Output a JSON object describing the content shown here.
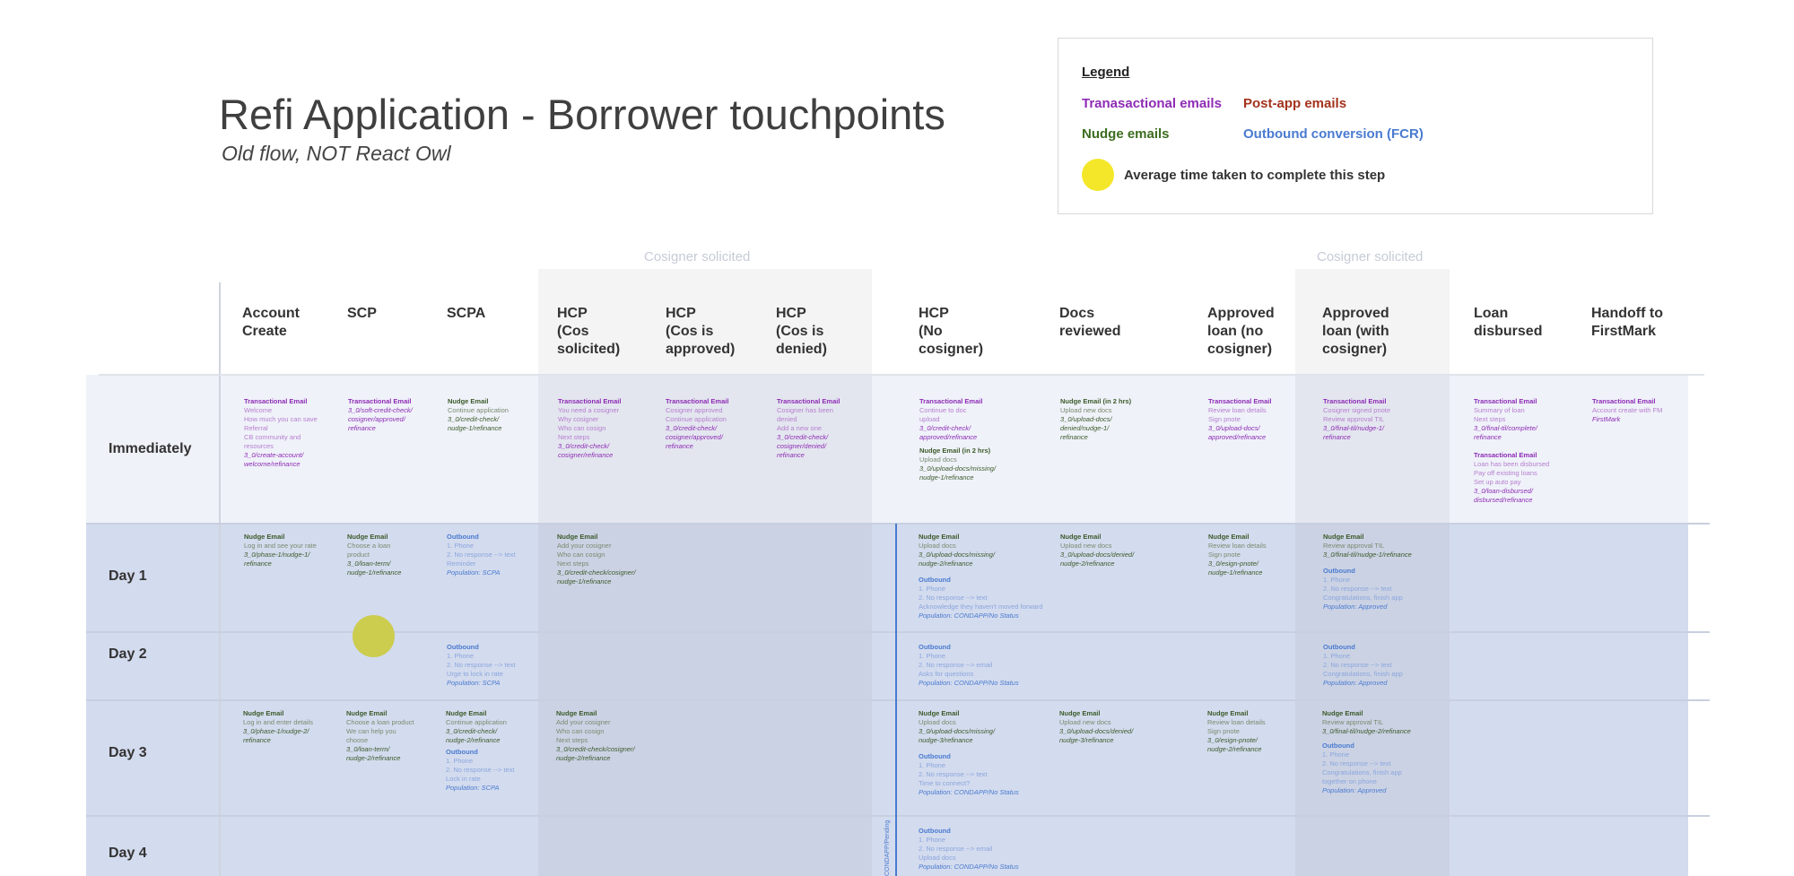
{
  "title": "Refi Application - Borrower touchpoints",
  "subtitle": "Old flow, NOT React Owl",
  "legend": {
    "title": "Legend",
    "transactional": "Tranasactional emails",
    "post_app": "Post-app emails",
    "nudge": "Nudge emails",
    "outbound": "Outbound conversion (FCR)",
    "avg_time": "Average time taken to complete this step",
    "colors": {
      "transactional": "#8e2bb5",
      "post_app": "#a3331d",
      "nudge": "#3c6d1f",
      "outbound": "#4a7bd0",
      "avg_dot": "#f4e72a"
    }
  },
  "cosigner_label_1": "Cosigner solicited",
  "cosigner_label_2": "Cosigner solicited",
  "columns": [
    "Account\nCreate",
    "SCP",
    "SCPA",
    "HCP\n(Cos\nsolicited)",
    "HCP\n(Cos is\napproved)",
    "HCP\n(Cos is\ndenied)",
    "HCP\n(No\ncosigner)",
    "Docs\nreviewed",
    "Approved\nloan (no\ncosigner)",
    "Approved\nloan (with\ncosigner)",
    "Loan\ndisbursed",
    "Handoff to\nFirstMark"
  ],
  "rows": [
    "Immediately",
    "Day 1",
    "Day 2",
    "Day 3",
    "Day 4"
  ],
  "vertical_note": "CONDAPP/Pending",
  "cells": {
    "imm_0": {
      "h": "Transactional Email",
      "b": "Welcome\nHow much you can save\nReferral\nCB community and\nresources",
      "l": "3_0/create-account/\nwelcome/refinance"
    },
    "imm_1": {
      "h": "Transactional Email",
      "b": "",
      "l": "3_0/soft-credit-check/\ncosigner/approved/\nrefinance"
    },
    "imm_2": {
      "h": "Nudge Email",
      "b": "Continue application",
      "l": "3_0/credit-check/\nnudge-1/refinance"
    },
    "imm_3": {
      "h": "Transactional Email",
      "b": "You need a cosigner\nWhy cosigner\nWho can cosign\nNext steps",
      "l": "3_0/credit-check/\ncosigner/refinance"
    },
    "imm_4": {
      "h": "Transactional Email",
      "b": "Cosigner approved\nContinue application",
      "l": "3_0/credit-check/\ncosigner/approved/\nrefinance"
    },
    "imm_5": {
      "h": "Transactional Email",
      "b": "Cosigner has been\ndenied\nAdd a new one",
      "l": "3_0/credit-check/\ncosigner/denied/\nrefinance"
    },
    "imm_6a": {
      "h": "Transactional Email",
      "b": "Continue to doc\nupload",
      "l": "3_0/credit-check/\napproved/refinance"
    },
    "imm_6b": {
      "h": "Nudge Email (in 2 hrs)",
      "b": "Upload docs",
      "l": "3_0/upload-docs/missing/\nnudge-1/refinance"
    },
    "imm_7": {
      "h": "Nudge Email (in 2 hrs)",
      "b": "Upload new docs",
      "l": "3_0/upload-docs/\ndenied/nudge-1/\nrefinance"
    },
    "imm_8": {
      "h": "Transactional Email",
      "b": "Review loan details\nSign pnote",
      "l": "3_0/upload-docs/\napproved/refinance"
    },
    "imm_9": {
      "h": "Transactional Email",
      "b": "Cosigner signed pnote\nReview approval TIL",
      "l": "3_0/final-til/nudge-1/\nrefinance"
    },
    "imm_10a": {
      "h": "Transactional Email",
      "b": "Summary of loan\nNext steps",
      "l": "3_0/final-til/complete/\nrefinance"
    },
    "imm_10b": {
      "h": "Transactional Email",
      "b": "Loan has been disbursed\nPay off existing loans\nSet up auto pay",
      "l": "3_0/loan-disbursed/\ndisbursed/refinance"
    },
    "imm_11": {
      "h": "Transactional Email",
      "b": "Account create with FM",
      "l": "FirstMark"
    },
    "d1_0": {
      "h": "Nudge Email",
      "b": "Log in and see your rate",
      "l": "3_0/phase-1/nudge-1/\nrefinance"
    },
    "d1_1": {
      "h": "Nudge Email",
      "b": "Choose a loan\nproduct",
      "l": "3_0/loan-term/\nnudge-1/refinance"
    },
    "d1_2": {
      "h": "Outbound",
      "b": "1. Phone\n2. No response --> text\nReminder",
      "l": "Population: SCPA"
    },
    "d1_3": {
      "h": "Nudge Email",
      "b": "Add your cosigner\nWho can cosign\nNext steps",
      "l": "3_0/credit-check/cosigner/\nnudge-1/refinance"
    },
    "d1_6a": {
      "h": "Nudge Email",
      "b": "Upload docs",
      "l": "3_0/upload-docs/missing/\nnudge-2/refinance"
    },
    "d1_6b": {
      "h": "Outbound",
      "b": "1. Phone\n2. No response --> text\nAcknowledge they haven't moved forward",
      "l": "Population: CONDAPP/No Status"
    },
    "d1_7": {
      "h": "Nudge Email",
      "b": "Upload new docs",
      "l": "3_0/upload-docs/denied/\nnudge-2/refinance"
    },
    "d1_8": {
      "h": "Nudge Email",
      "b": "Review loan details\nSign pnote",
      "l": "3_0/esign-pnote/\nnudge-1/refinance"
    },
    "d1_9a": {
      "h": "Nudge Email",
      "b": "Review approval TIL",
      "l": "3_0/final-til/nudge-1/refinance"
    },
    "d1_9b": {
      "h": "Outbound",
      "b": "1. Phone\n2. No response --> text\nCongratulations, finish app",
      "l": "Population: Approved"
    },
    "d2_2": {
      "h": "Outbound",
      "b": "1. Phone\n2. No response --> text\nUrge to lock in rate",
      "l": "Population: SCPA"
    },
    "d2_6": {
      "h": "Outbound",
      "b": "1. Phone\n2. No response --> email\nAsks for questions",
      "l": "Population: CONDAPP/No Status"
    },
    "d2_9": {
      "h": "Outbound",
      "b": "1. Phone\n2. No response --> text\nCongratulations, finish app",
      "l": "Population: Approved"
    },
    "d3_0": {
      "h": "Nudge Email",
      "b": "Log in and enter details",
      "l": "3_0/phase-1/nudge-2/\nrefinance"
    },
    "d3_1": {
      "h": "Nudge Email",
      "b": "Choose a loan product\nWe can help you\nchoose",
      "l": "3_0/loan-term/\nnudge-2/refinance"
    },
    "d3_2a": {
      "h": "Nudge Email",
      "b": "Continue application",
      "l": "3_0/credit-check/\nnudge-2/refinance"
    },
    "d3_2b": {
      "h": "Outbound",
      "b": "1. Phone\n2. No response --> text\nLock in rate",
      "l": "Population: SCPA"
    },
    "d3_3": {
      "h": "Nudge Email",
      "b": "Add your cosigner\nWho can cosign\nNext steps",
      "l": "3_0/credit-check/cosigner/\nnudge-2/refinance"
    },
    "d3_6a": {
      "h": "Nudge Email",
      "b": "Upload docs",
      "l": "3_0/upload-docs/missing/\nnudge-3/refinance"
    },
    "d3_6b": {
      "h": "Outbound",
      "b": "1. Phone\n2. No response --> text\nTime to connect?",
      "l": "Population: CONDAPP/No Status"
    },
    "d3_7": {
      "h": "Nudge Email",
      "b": "Upload new docs",
      "l": "3_0/upload-docs/denied/\nnudge-3/refinance"
    },
    "d3_8": {
      "h": "Nudge Email",
      "b": "Review loan details\nSign pnote",
      "l": "3_0/esign-pnote/\nnudge-2/refinance"
    },
    "d3_9a": {
      "h": "Nudge Email",
      "b": "Review approval TIL",
      "l": "3_0/final-til/nudge-2/refinance"
    },
    "d3_9b": {
      "h": "Outbound",
      "b": "1. Phone\n2. No response --> text\nCongratulations, finish app\ntogether on phone",
      "l": "Population: Approved"
    },
    "d4_6": {
      "h": "Outbound",
      "b": "1. Phone\n2. No response --> email\nUpload docs",
      "l": "Population: CONDAPP/No Status"
    }
  }
}
